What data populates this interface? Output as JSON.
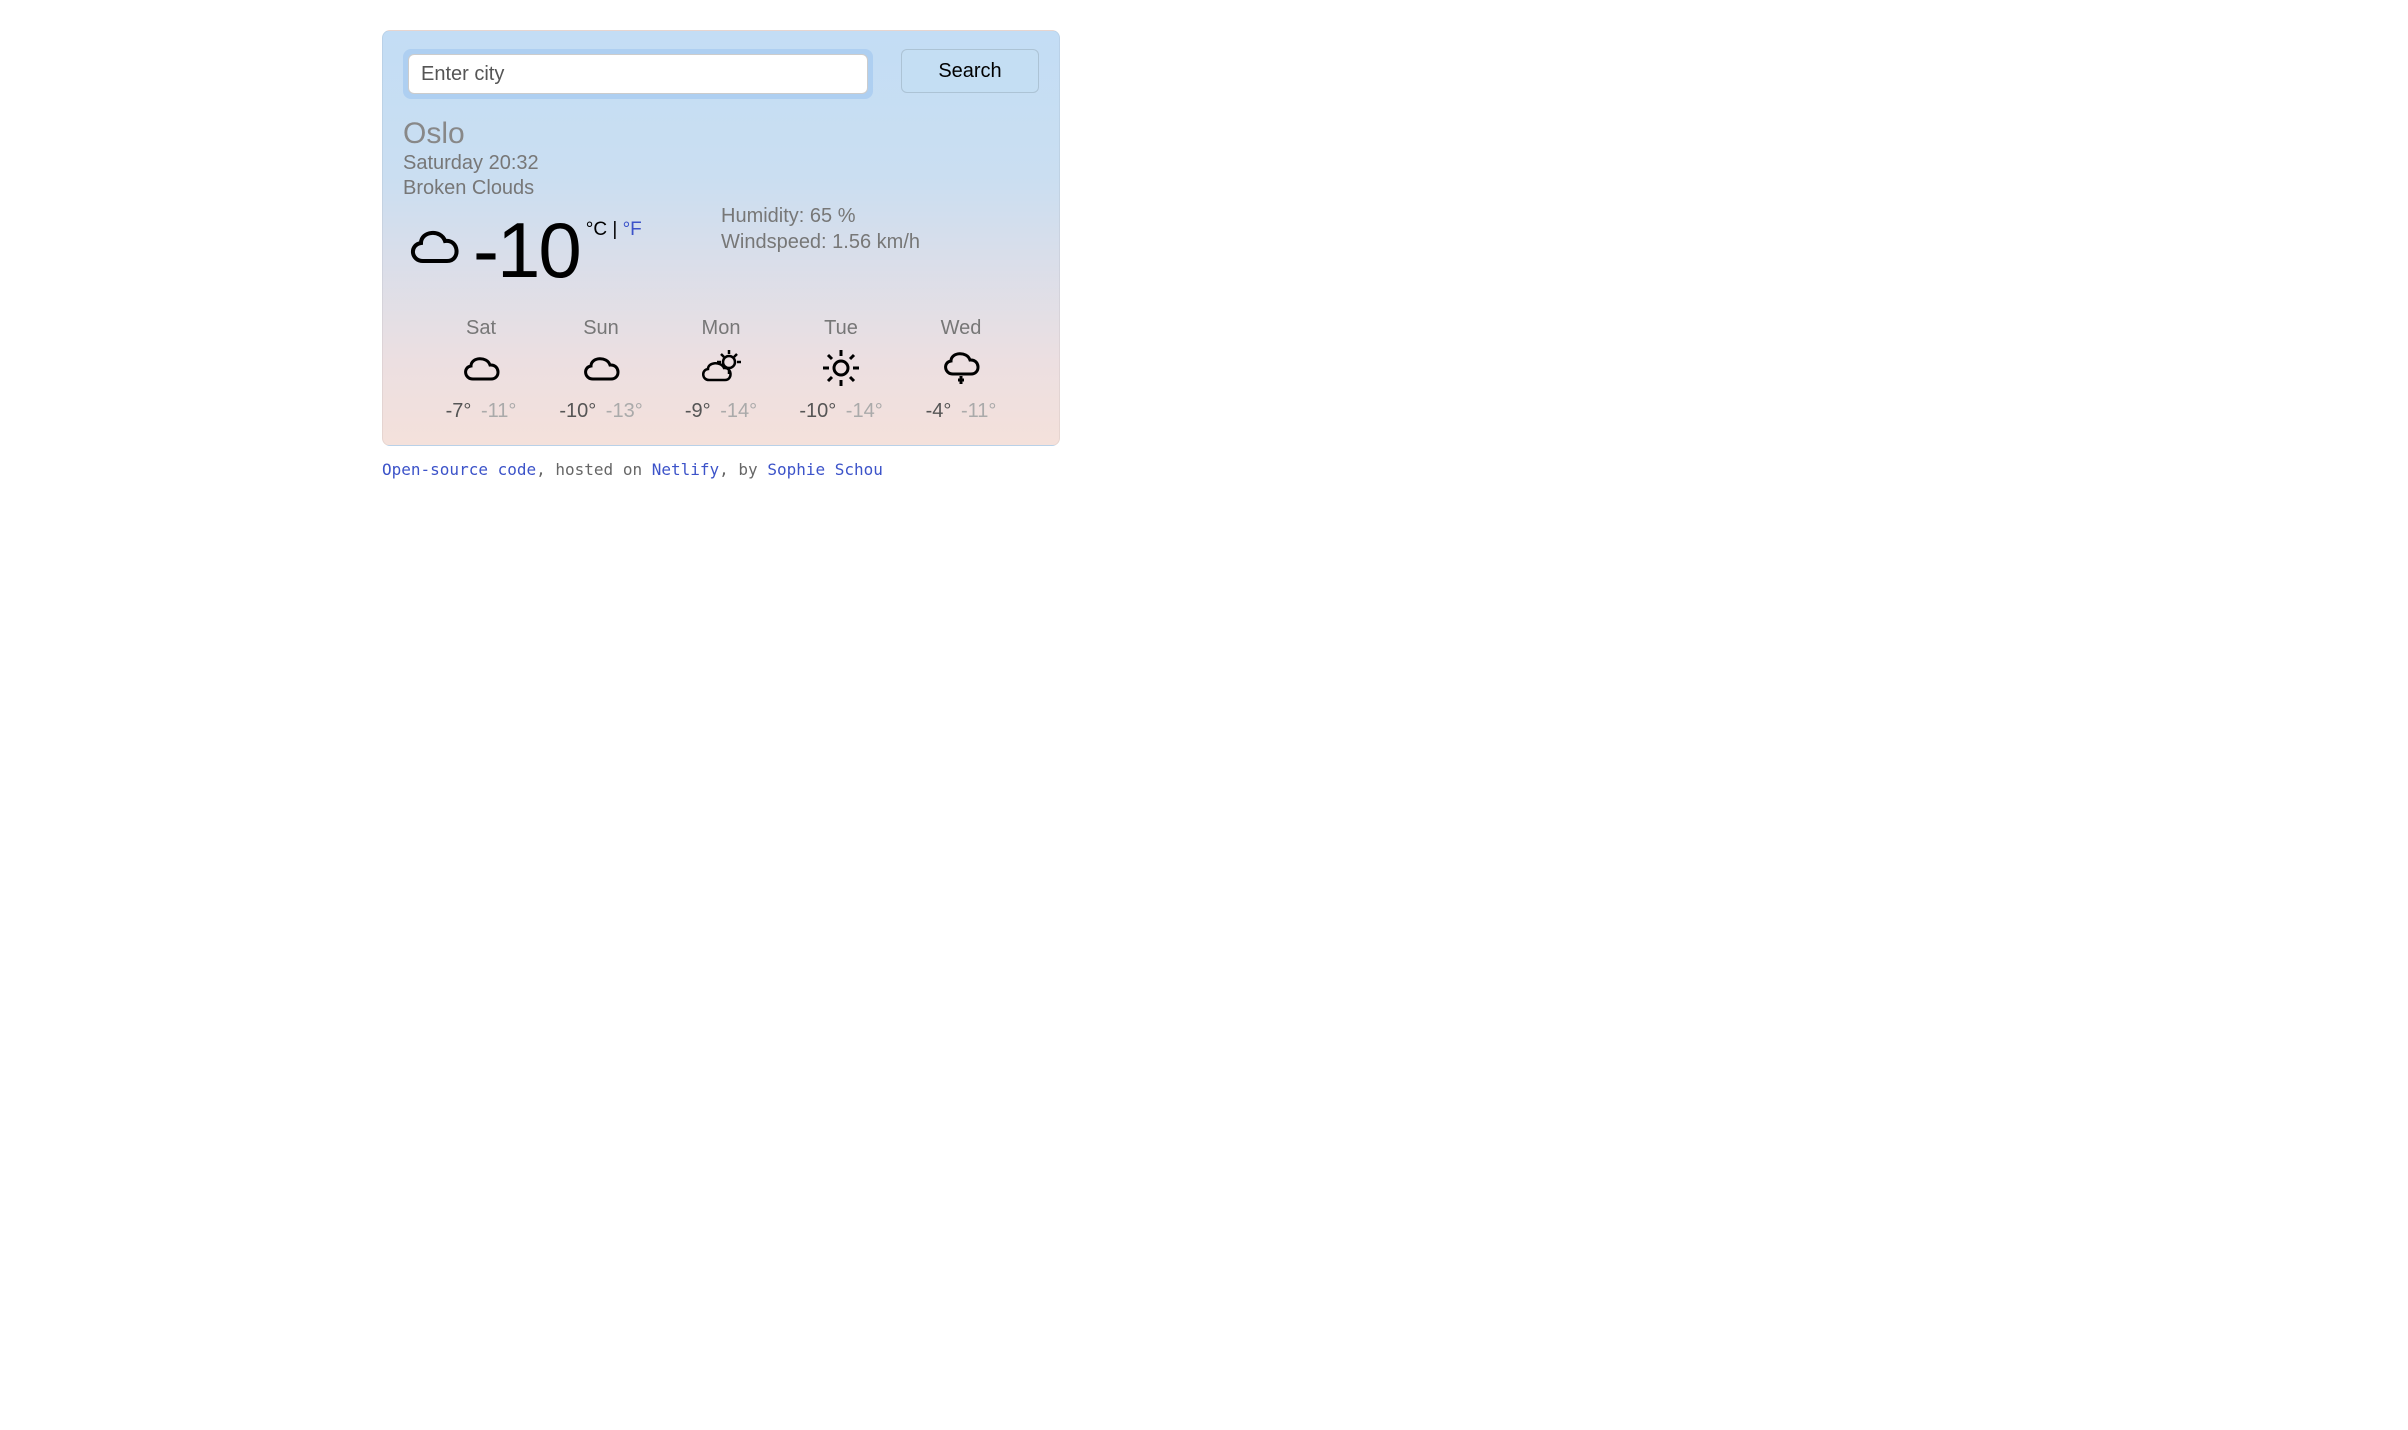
{
  "search": {
    "placeholder": "Enter city",
    "button": "Search"
  },
  "city": "Oslo",
  "datetime": "Saturday 20:32",
  "description": "Broken Clouds",
  "temperature": "-10",
  "units": {
    "c": "°C",
    "sep": " | ",
    "f": "°F"
  },
  "humidity_label": "Humidity: ",
  "humidity_value": "65 %",
  "wind_label": "Windspeed: ",
  "wind_value": "1.56 km/h",
  "forecast": [
    {
      "day": "Sat",
      "icon": "cloud",
      "hi": "-7°",
      "lo": "-11°"
    },
    {
      "day": "Sun",
      "icon": "cloud",
      "hi": "-10°",
      "lo": "-13°"
    },
    {
      "day": "Mon",
      "icon": "partly",
      "hi": "-9°",
      "lo": "-14°"
    },
    {
      "day": "Tue",
      "icon": "sun",
      "hi": "-10°",
      "lo": "-14°"
    },
    {
      "day": "Wed",
      "icon": "snowcloud",
      "hi": "-4°",
      "lo": "-11°"
    }
  ],
  "footer": {
    "opensource": "Open-source code",
    "hosted": ", hosted on ",
    "netlify": "Netlify",
    "by": ", by ",
    "author": "Sophie Schou"
  }
}
